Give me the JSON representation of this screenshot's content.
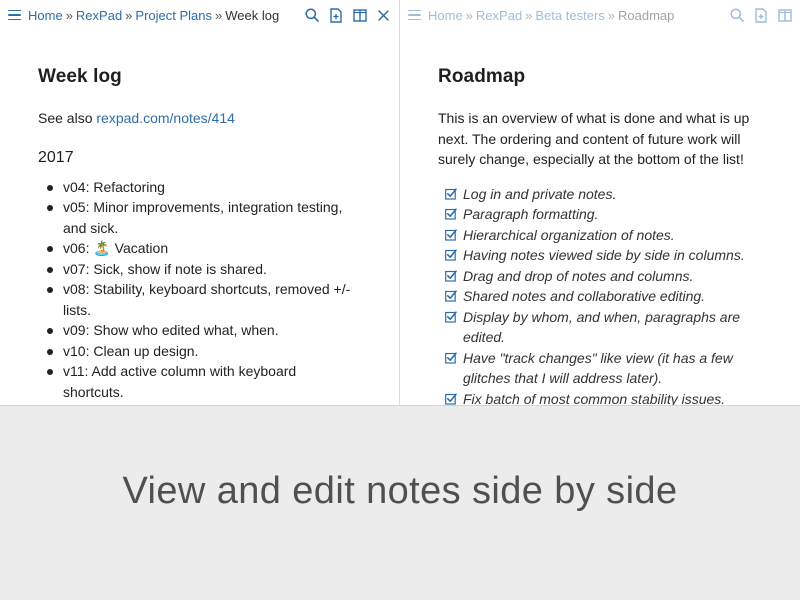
{
  "left_column": {
    "breadcrumb": [
      {
        "label": "Home",
        "link": true
      },
      {
        "label": "RexPad",
        "link": true
      },
      {
        "label": "Project Plans",
        "link": true
      },
      {
        "label": "Week log",
        "link": false
      }
    ],
    "separator": "»",
    "title": "Week log",
    "see_also_prefix": "See also",
    "see_also_link": "rexpad.com/notes/414",
    "subheading": "2017",
    "items": [
      "v04: Refactoring",
      "v05: Minor improvements, integration testing, and sick.",
      "v06: 🏝️ Vacation",
      "v07: Sick, show if note is shared.",
      "v08: Stability, keyboard shortcuts, removed +/- lists.",
      "v09: Show who edited what, when.",
      "v10: Clean up design.",
      "v11: Add active column with keyboard shortcuts."
    ]
  },
  "right_column": {
    "breadcrumb": [
      {
        "label": "Home",
        "link": true
      },
      {
        "label": "RexPad",
        "link": true
      },
      {
        "label": "Beta testers",
        "link": true
      },
      {
        "label": "Roadmap",
        "link": false
      }
    ],
    "separator": "»",
    "title": "Roadmap",
    "intro": "This is an overview of what is done and what is up next. The ordering and content of future work will surely change, especially at the bottom of the list!",
    "items": [
      "Log in and private notes.",
      "Paragraph formatting.",
      "Hierarchical organization of notes.",
      "Having notes viewed side by side in columns.",
      "Drag and drop of notes and columns.",
      "Shared notes and collaborative editing.",
      "Display by whom, and when, paragraphs are edited.",
      "Have \"track changes\" like view (it has a few glitches that I will address later).",
      "Fix batch of most common stability issues."
    ]
  },
  "caption": "View and edit notes side by side",
  "colors": {
    "accent": "#2f6da8",
    "caption_bg": "#ececec"
  }
}
